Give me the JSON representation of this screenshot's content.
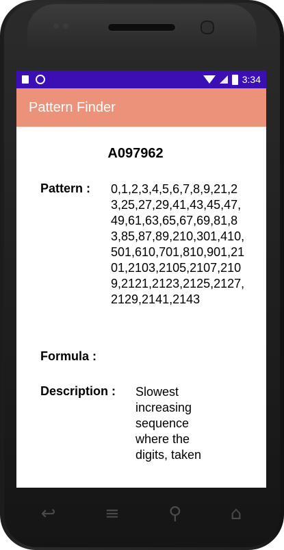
{
  "statusbar": {
    "time": "3:34"
  },
  "appbar": {
    "title": "Pattern Finder"
  },
  "sequence": {
    "id": "A097962",
    "pattern_label": "Pattern :",
    "pattern_value": "0,1,2,3,4,5,6,7,8,9,21,23,25,27,29,41,43,45,47,49,61,63,65,67,69,81,83,85,87,89,210,301,410,501,610,701,810,901,2101,2103,2105,2107,2109,2121,2123,2125,2127,2129,2141,2143",
    "formula_label": "Formula :",
    "formula_value": "",
    "description_label": "Description :",
    "description_value": "Slowest increasing sequence where the digits, taken"
  },
  "navbar": {
    "back_icon": "back-icon",
    "home_icon": "home-icon",
    "search_icon": "search-icon",
    "menu_icon": "menu-icon"
  },
  "colors": {
    "statusbar": "#3b0fb3",
    "appbar": "#ec917a"
  }
}
